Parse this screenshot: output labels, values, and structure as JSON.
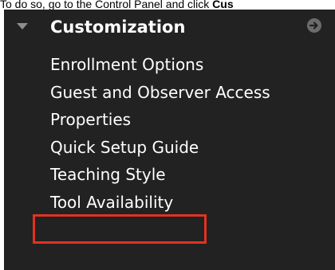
{
  "caption": {
    "text_before": "To do so, go to the Control Panel and click ",
    "text_bold": "Cus"
  },
  "panel": {
    "section_title": "Customization",
    "items": [
      {
        "label": "Enrollment Options"
      },
      {
        "label": "Guest and Observer Access"
      },
      {
        "label": "Properties"
      },
      {
        "label": "Quick Setup Guide"
      },
      {
        "label": "Teaching Style"
      },
      {
        "label": "Tool Availability"
      }
    ],
    "highlighted_item": "Tool Availability"
  },
  "colors": {
    "panel_background": "#222222",
    "text": "#ffffff",
    "highlight_border": "#e2321f",
    "icon_gray": "#8f8f8f"
  },
  "icons": {
    "collapse": "triangle-down-icon",
    "go": "arrow-right-circle-icon"
  }
}
